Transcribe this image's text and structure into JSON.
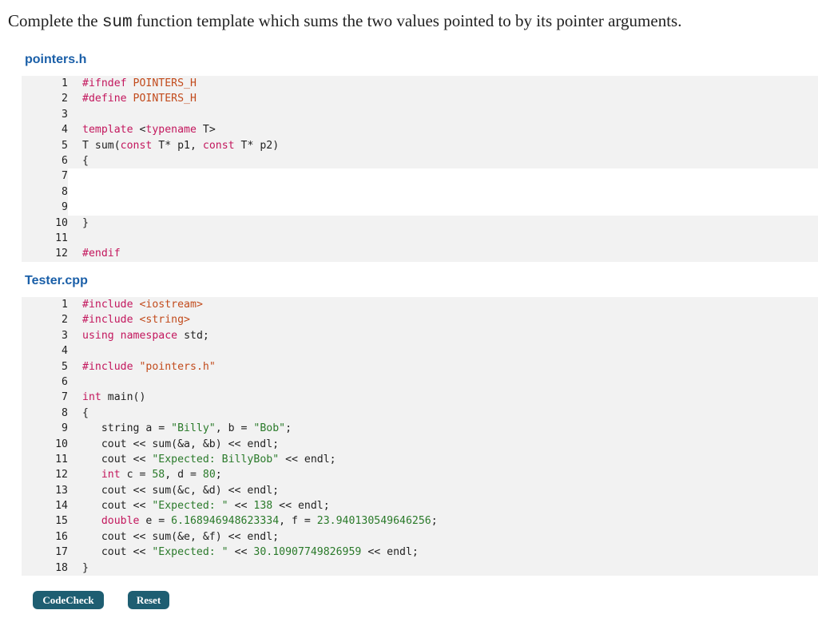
{
  "prompt": {
    "before": "Complete the ",
    "code_word": "sum",
    "after": " function template which sums the two values pointed to by its pointer arguments."
  },
  "files": [
    {
      "name": "pointers.h",
      "lines": [
        {
          "n": "1",
          "text": "#ifndef POINTERS_H",
          "editable": false
        },
        {
          "n": "2",
          "text": "#define POINTERS_H",
          "editable": false
        },
        {
          "n": "3",
          "text": "",
          "editable": false
        },
        {
          "n": "4",
          "text": "template <typename T>",
          "editable": false
        },
        {
          "n": "5",
          "text": "T sum(const T* p1, const T* p2)",
          "editable": false
        },
        {
          "n": "6",
          "text": "{",
          "editable": false
        },
        {
          "n": "7",
          "text": "",
          "editable": true
        },
        {
          "n": "8",
          "text": "",
          "editable": true
        },
        {
          "n": "9",
          "text": "",
          "editable": true
        },
        {
          "n": "10",
          "text": "}",
          "editable": false
        },
        {
          "n": "11",
          "text": "",
          "editable": false
        },
        {
          "n": "12",
          "text": "#endif",
          "editable": false
        }
      ]
    },
    {
      "name": "Tester.cpp",
      "lines": [
        {
          "n": "1",
          "text": "#include <iostream>",
          "editable": false
        },
        {
          "n": "2",
          "text": "#include <string>",
          "editable": false
        },
        {
          "n": "3",
          "text": "using namespace std;",
          "editable": false
        },
        {
          "n": "4",
          "text": "",
          "editable": false
        },
        {
          "n": "5",
          "text": "#include \"pointers.h\"",
          "editable": false
        },
        {
          "n": "6",
          "text": "",
          "editable": false
        },
        {
          "n": "7",
          "text": "int main()",
          "editable": false
        },
        {
          "n": "8",
          "text": "{",
          "editable": false
        },
        {
          "n": "9",
          "text": "   string a = \"Billy\", b = \"Bob\";",
          "editable": false
        },
        {
          "n": "10",
          "text": "   cout << sum(&a, &b) << endl;",
          "editable": false
        },
        {
          "n": "11",
          "text": "   cout << \"Expected: BillyBob\" << endl;",
          "editable": false
        },
        {
          "n": "12",
          "text": "   int c = 58, d = 80;",
          "editable": false
        },
        {
          "n": "13",
          "text": "   cout << sum(&c, &d) << endl;",
          "editable": false
        },
        {
          "n": "14",
          "text": "   cout << \"Expected: \" << 138 << endl;",
          "editable": false
        },
        {
          "n": "15",
          "text": "   double e = 6.168946948623334, f = 23.940130549646256;",
          "editable": false
        },
        {
          "n": "16",
          "text": "   cout << sum(&e, &f) << endl;",
          "editable": false
        },
        {
          "n": "17",
          "text": "   cout << \"Expected: \" << 30.10907749826959 << endl;",
          "editable": false
        },
        {
          "n": "18",
          "text": "}",
          "editable": false
        }
      ]
    }
  ],
  "buttons": {
    "codecheck": "CodeCheck",
    "reset": "Reset"
  },
  "colors": {
    "title_blue": "#1a5fa8",
    "keyword": "#c3175d",
    "string": "#2a7a2a",
    "include_path": "#c24b1c",
    "button_bg": "#1e5e72"
  }
}
